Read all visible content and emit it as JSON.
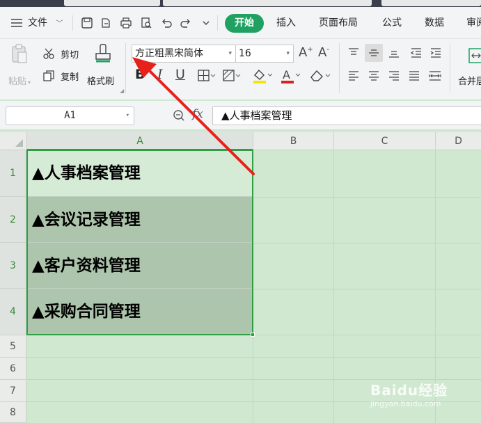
{
  "menu": {
    "file_label": "文件",
    "tabs": [
      "开始",
      "插入",
      "页面布局",
      "公式",
      "数据",
      "审阅"
    ]
  },
  "ribbon": {
    "paste_label": "粘贴",
    "cut_label": "剪切",
    "copy_label": "复制",
    "format_painter_label": "格式刷",
    "font_name": "方正粗黑宋简体",
    "font_size": "16",
    "bold_glyph": "B",
    "italic_glyph": "I",
    "underline_glyph": "U",
    "merge_label": "合并居",
    "colors": {
      "highlight": "#f5e600",
      "font": "#e02020",
      "accent": "#20a162"
    }
  },
  "formula_bar": {
    "cell_ref": "A1",
    "fx_label": "fx",
    "content": "▲人事档案管理"
  },
  "sheet": {
    "columns": [
      "A",
      "B",
      "C",
      "D"
    ],
    "rows": [
      {
        "num": "1",
        "a": "▲人事档案管理"
      },
      {
        "num": "2",
        "a": "▲会议记录管理"
      },
      {
        "num": "3",
        "a": "▲客户资料管理"
      },
      {
        "num": "4",
        "a": "▲采购合同管理"
      },
      {
        "num": "5",
        "a": ""
      },
      {
        "num": "6",
        "a": ""
      },
      {
        "num": "7",
        "a": ""
      },
      {
        "num": "8",
        "a": ""
      }
    ]
  },
  "watermark": {
    "brand": "Baidu经验",
    "url": "jingyan.baidu.com"
  }
}
